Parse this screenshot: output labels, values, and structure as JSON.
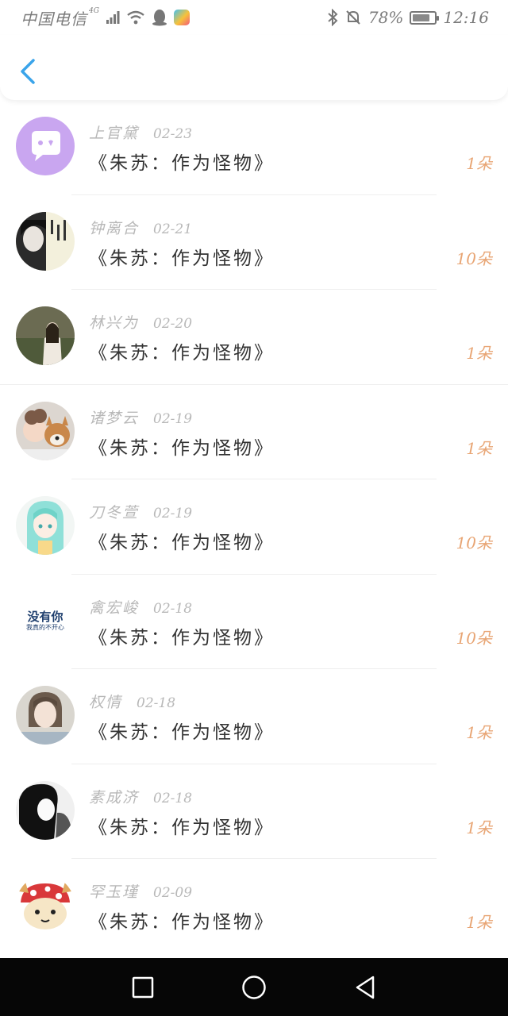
{
  "status_bar": {
    "carrier": "中国电信",
    "network": "4G",
    "battery": "78%",
    "battery_level": 0.78,
    "time": "12:16"
  },
  "icons": {
    "back": "chevron-left-icon",
    "square": "recent-apps-icon",
    "circle": "home-icon",
    "triangle": "back-triangle-icon"
  },
  "colors": {
    "accent": "#3aa4ea",
    "count": "#e8a574"
  },
  "items": [
    {
      "name": "上官黛",
      "date": "02-23",
      "title": "《朱苏：作为怪物》",
      "count": "1朵"
    },
    {
      "name": "钟离合",
      "date": "02-21",
      "title": "《朱苏：作为怪物》",
      "count": "10朵"
    },
    {
      "name": "林兴为",
      "date": "02-20",
      "title": "《朱苏：作为怪物》",
      "count": "1朵"
    },
    {
      "name": "诸梦云",
      "date": "02-19",
      "title": "《朱苏：作为怪物》",
      "count": "1朵"
    },
    {
      "name": "刀冬萱",
      "date": "02-19",
      "title": "《朱苏：作为怪物》",
      "count": "10朵"
    },
    {
      "name": "禽宏峻",
      "date": "02-18",
      "title": "《朱苏：作为怪物》",
      "count": "10朵",
      "avatar_text_1": "没有你",
      "avatar_text_2": "我真的不开心"
    },
    {
      "name": "权情",
      "date": "02-18",
      "title": "《朱苏：作为怪物》",
      "count": "1朵"
    },
    {
      "name": "素成济",
      "date": "02-18",
      "title": "《朱苏：作为怪物》",
      "count": "1朵"
    },
    {
      "name": "罕玉瑾",
      "date": "02-09",
      "title": "《朱苏：作为怪物》",
      "count": "1朵"
    }
  ]
}
